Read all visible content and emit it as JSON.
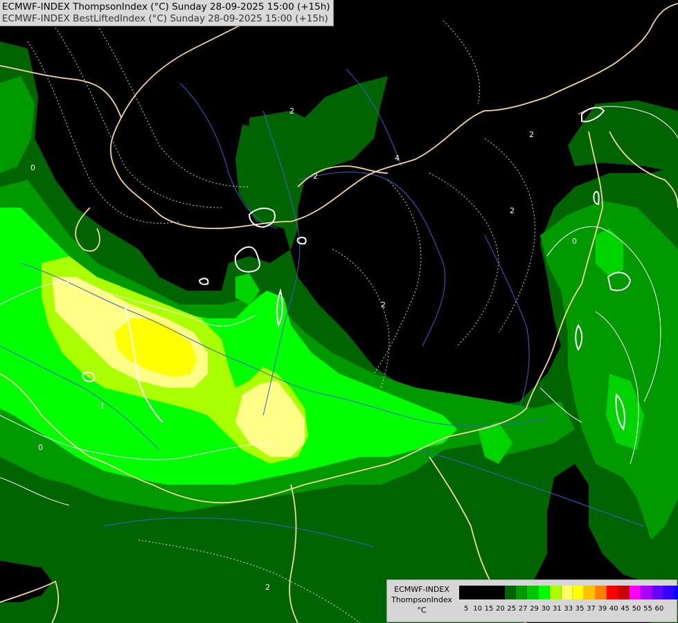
{
  "header": {
    "line1": "ECMWF-INDEX ThompsonIndex (°C) Sunday 28-09-2025 15:00 (+15h)",
    "line2": "ECMWF-INDEX BestLiftedIndex (°C) Sunday 28-09-2025 15:00 (+15h)"
  },
  "legend": {
    "line1": "ECMWF-INDEX",
    "line2": "ThompsonIndex",
    "unit": "°C",
    "ticks": [
      "5",
      "10",
      "15",
      "20",
      "25",
      "27",
      "29",
      "30",
      "31",
      "33",
      "35",
      "37",
      "39",
      "40",
      "45",
      "50",
      "55",
      "60"
    ],
    "colors": [
      "#000000",
      "#000000",
      "#000000",
      "#000000",
      "#006400",
      "#009a00",
      "#00c800",
      "#00ff00",
      "#aaff00",
      "#ffff66",
      "#ffff00",
      "#ffc000",
      "#ff8000",
      "#ff0000",
      "#cc0000",
      "#ff00ff",
      "#aa00ff",
      "#6600ff",
      "#3300ff",
      "#0000ff"
    ]
  },
  "contour_labels": {
    "l1": "0",
    "l2": "2",
    "l3": "2",
    "l4": "2",
    "l5": "2",
    "l6": "2",
    "l7": "0",
    "l8": "0",
    "l9": "-1",
    "l10": "2",
    "l11": "4"
  },
  "field_colors": {
    "background": "#000000",
    "dark_green": "#006400",
    "mid_green": "#009a00",
    "bright_green": "#00ff00",
    "lime": "#aaff00",
    "pale_yellow": "#ffff80",
    "yellow": "#ffff00",
    "border": "#f5d7a0",
    "river": "#3a5fcd",
    "contour": "#ffffff"
  }
}
